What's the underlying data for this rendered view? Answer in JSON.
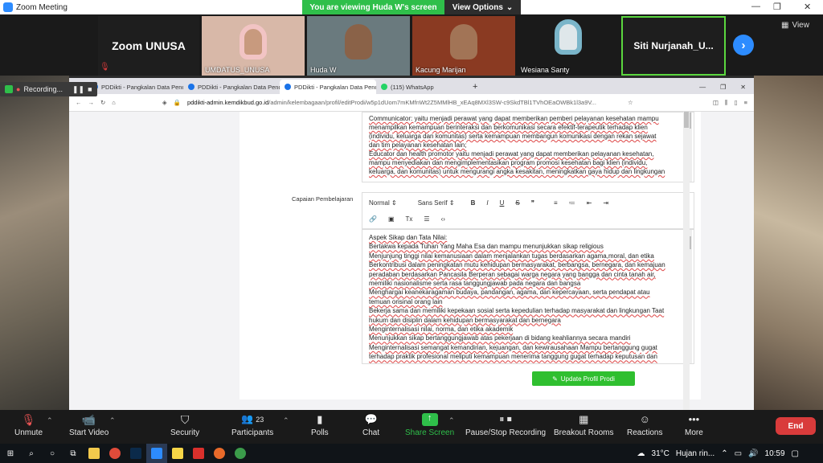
{
  "window": {
    "title": "Zoom Meeting"
  },
  "banner": {
    "viewing": "You are viewing Huda W's screen",
    "view_options": "View Options"
  },
  "gallery": {
    "view_label": "View",
    "tiles": [
      {
        "name": "Zoom UNUSA"
      },
      {
        "name": "UMDATUS_UNUSA"
      },
      {
        "name": "Huda W"
      },
      {
        "name": "Kacung Marijan"
      },
      {
        "name": "Wesiana Santy"
      },
      {
        "name": "Siti  Nurjanah_U..."
      }
    ]
  },
  "recording": {
    "label": "Recording..."
  },
  "browser": {
    "tabs": [
      {
        "label": "PDDikti - Pangkalan Data Pendi"
      },
      {
        "label": "PDDikti - Pangkalan Data Pendi"
      },
      {
        "label": "PDDikti - Pangkalan Data Pendi"
      },
      {
        "label": "(115) WhatsApp"
      }
    ],
    "new_tab": "+",
    "url_domain": "pddikti-admin.kemdikbud.go.id",
    "url_path": "/admin/kelembagaan/profil/editProdi/w5p1dUom7mKMfnWt2Z5MMlHB_xEAq8MXl3SW-c9SkdTBl1TVhOEaOWBk1l3a9V...",
    "page": {
      "textarea1_lines": [
        "Communicator: yaitu menjadi perawat yang dapat memberikan pemberi pelayanan kesehatan mampu",
        "menampilkan kemampuan berinteraksi dan berkomunikasi secara efektif-terapeutik terhadap klien",
        "(individu, keluarga dan komunitas) serta kemampuan membangun komunikasi dengan rekan sejawat",
        "dan tim pelayanan kesehatan lain;",
        "Educator dan health promotor  yaitu menjadi perawat yang dapat memberikan pelayanan kesehatan,",
        "mampu menyediakan dan mengimplementasikan program promosi kesehatan bagi klien (individu,",
        "keluarga, dan komunitas) untuk mengurangi angka kesakitan, meningkatkan gaya hidup dan lingkungan"
      ],
      "field_label": "Capaian Pembelajaran",
      "toolbar": {
        "format": "Normal",
        "font": "Sans Serif",
        "bold": "B",
        "italic": "I",
        "underline": "U",
        "strike": "S",
        "quote": "❞",
        "ordered": "≡",
        "bullet": "≔",
        "outdent": "⇤",
        "indent": "⇥",
        "link": "🔗",
        "image": "▣",
        "clean": "Tx",
        "align": "☰",
        "code": "‹›"
      },
      "editor_lines": [
        "Aspek Sikap dan Tata Nilai:",
        "Bertakwa kepada Tuhan Yang Maha Esa dan mampu menunjukkan sikap religious",
        "Menjunjung tinggi nilai kemanusiaan dalam menjalankan tugas berdasarkan agama,moral, dan etika",
        "Berkontribusi dalam peningkatan mutu kehidupan bermasyarakat, berbangsa, bernegara, dan kemajuan",
        "peradaban berdasarkan Pancasila Berperan sebagai warga negara yang bangga dan cinta tanah air,",
        "memiliki nasionalisme serta rasa tanggungjawab pada negara dan bangsa",
        "Menghargai keanekaragaman budaya, pandangan, agama, dan kepercayaan, serta pendapat atau",
        "temuan orisinal orang lain",
        "Bekerja sama dan memiliki kepekaan sosial serta kepedulian terhadap masyarakat dan lingkungan Taat",
        "hukum dan disiplin dalam kehidupan bermasyarakat dan bernegara",
        "Menginternalisasi nilai, norma, dan etika akademik",
        "Menunjukkan sikap bertanggungjawab atas pekerjaan di bidang keahliannya secara mandiri",
        "Menginternalisasi semangat kemandirian, kejuangan, dan kewirausahaan Mampu bertanggung gugat",
        "terhadap praktik profesional meliputi kemampuan menerima tanggung gugat terhadap keputusan dan"
      ],
      "update_button": "Update Profil Prodi"
    }
  },
  "controls": {
    "unmute": "Unmute",
    "start_video": "Start Video",
    "security": "Security",
    "participants": "Participants",
    "participant_count": "23",
    "polls": "Polls",
    "chat": "Chat",
    "share_screen": "Share Screen",
    "pause_recording": "Pause/Stop Recording",
    "breakout": "Breakout Rooms",
    "reactions": "Reactions",
    "more": "More",
    "end": "End"
  },
  "taskbar": {
    "temperature": "31°C",
    "weather": "Hujan rin...",
    "time": "10:59"
  },
  "colors": {
    "zoom_blue": "#2d8cff",
    "share_green": "#2fbf4a",
    "end_red": "#d93b3b",
    "update_green": "#2fbf2f"
  }
}
